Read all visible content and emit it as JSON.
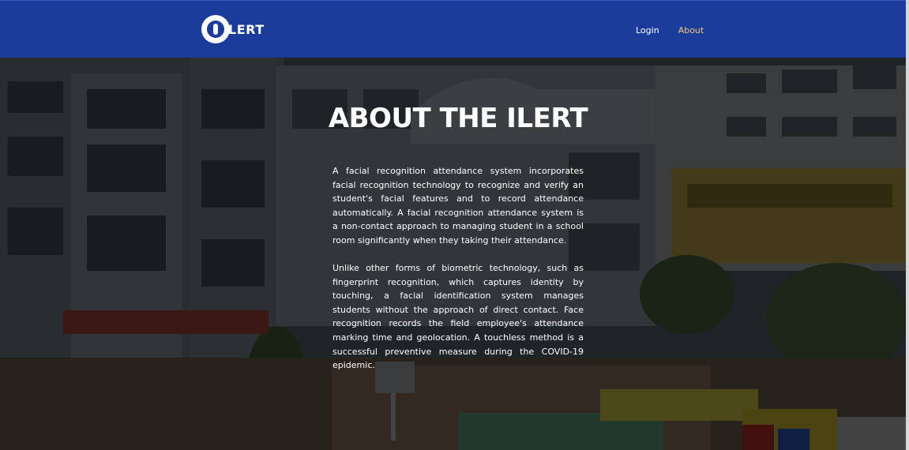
{
  "navbar": {
    "brand_text": "LERT",
    "links": [
      {
        "label": "Login",
        "active": false
      },
      {
        "label": "About",
        "active": true
      }
    ]
  },
  "hero": {
    "title": "ABOUT THE ILERT",
    "paragraphs": [
      "A facial recognition attendance system incorporates facial recognition technology to recognize and verify an student's facial features and to record attendance automatically. A facial recognition attendance system is a non-contact approach to managing student in a school room significantly when they taking their attendance.",
      "Unlike other forms of biometric technology, such as fingerprint recognition, which captures identity by touching, a facial identification system manages students without the approach of direct contact. Face recognition records the field employee's attendance marking time and geolocation. A touchless method is a successful preventive measure during the COVID-19 epidemic."
    ]
  },
  "colors": {
    "navbar_bg": "#1c3c9c",
    "active_link": "#f0c674",
    "text": "#ffffff"
  }
}
